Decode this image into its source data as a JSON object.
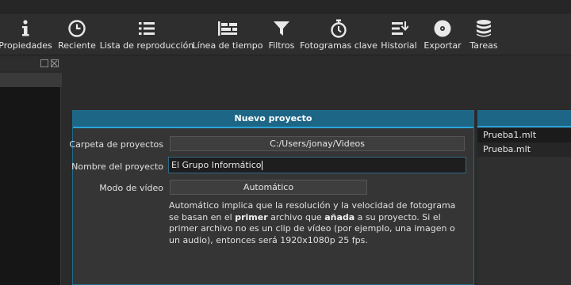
{
  "toolbar": {
    "items": [
      {
        "label": "Propiedades",
        "icon": "info-icon"
      },
      {
        "label": "Reciente",
        "icon": "clock-icon"
      },
      {
        "label": "Lista de reproducción",
        "icon": "list-icon"
      },
      {
        "label": "Línea de tiempo",
        "icon": "timeline-icon"
      },
      {
        "label": "Filtros",
        "icon": "filter-icon"
      },
      {
        "label": "Fotogramas clave",
        "icon": "stopwatch-icon"
      },
      {
        "label": "Historial",
        "icon": "history-icon"
      },
      {
        "label": "Exportar",
        "icon": "disc-icon"
      },
      {
        "label": "Tareas",
        "icon": "database-icon"
      }
    ]
  },
  "dialog": {
    "title": "Nuevo proyecto",
    "folder_label": "Carpeta de proyectos",
    "folder_value": "C:/Users/jonay/Videos",
    "name_label": "Nombre del proyecto",
    "name_value": "El Grupo Informático",
    "mode_label": "Modo de vídeo",
    "mode_value": "Automático",
    "desc_part1": "Automático implica que la resolución y la velocidad de fotograma se basan en el ",
    "desc_bold1": "primer",
    "desc_part2": " archivo que ",
    "desc_bold2": "añada",
    "desc_part3": " a su proyecto. Si el primer archivo no es un clip de vídeo (por ejemplo, una imagen o un audio), entonces será 1920x1080p 25 fps."
  },
  "recent_projects": {
    "items": [
      "Prueba1.mlt",
      "Prueba.mlt"
    ]
  },
  "colors": {
    "accent": "#2aa3d6",
    "title_bar": "#1e6686",
    "background": "#2b2b2b"
  }
}
